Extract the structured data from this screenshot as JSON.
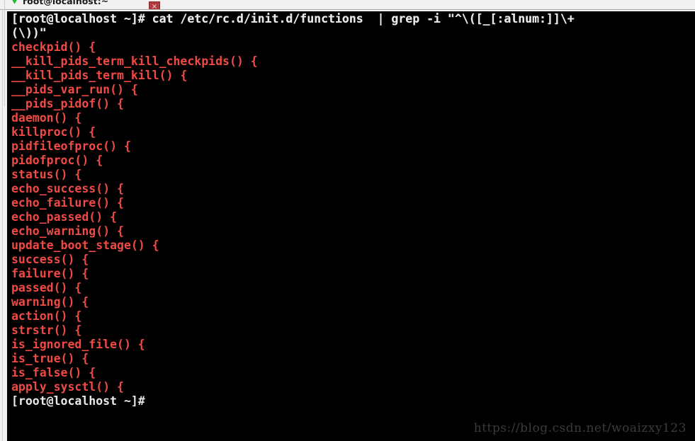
{
  "window": {
    "title": "root@localhost:~",
    "tab_icon": "terminal-green-arrow-icon",
    "close_label": "×"
  },
  "colors": {
    "background": "#000000",
    "command_text": "#e8e8e8",
    "match_text": "#f04a45",
    "chrome": "#f2f1f0",
    "close_button": "#b33a3a",
    "watermark": "#3b3b3b",
    "tab_icon_green": "#22bb33"
  },
  "terminal": {
    "prompt": "[root@localhost ~]#",
    "command": "cat /etc/rc.d/init.d/functions  | grep -i \"^\\([_[:alnum:]]\\+(\\))\"",
    "command_line_1": "[root@localhost ~]# cat /etc/rc.d/init.d/functions  | grep -i \"^\\([_[:alnum:]]\\+",
    "command_line_2": "(\\))\"",
    "trailing_prompt": "[root@localhost ~]#",
    "output_lines": [
      "checkpid() {",
      "__kill_pids_term_kill_checkpids() {",
      "__kill_pids_term_kill() {",
      "__pids_var_run() {",
      "__pids_pidof() {",
      "daemon() {",
      "killproc() {",
      "pidfileofproc() {",
      "pidofproc() {",
      "status() {",
      "echo_success() {",
      "echo_failure() {",
      "echo_passed() {",
      "echo_warning() {",
      "update_boot_stage() {",
      "success() {",
      "failure() {",
      "passed() {",
      "warning() {",
      "action() {",
      "strstr() {",
      "is_ignored_file() {",
      "is_true() {",
      "is_false() {",
      "apply_sysctl() {"
    ]
  },
  "watermark": {
    "text": "https://blog.csdn.net/woaizxy123"
  }
}
